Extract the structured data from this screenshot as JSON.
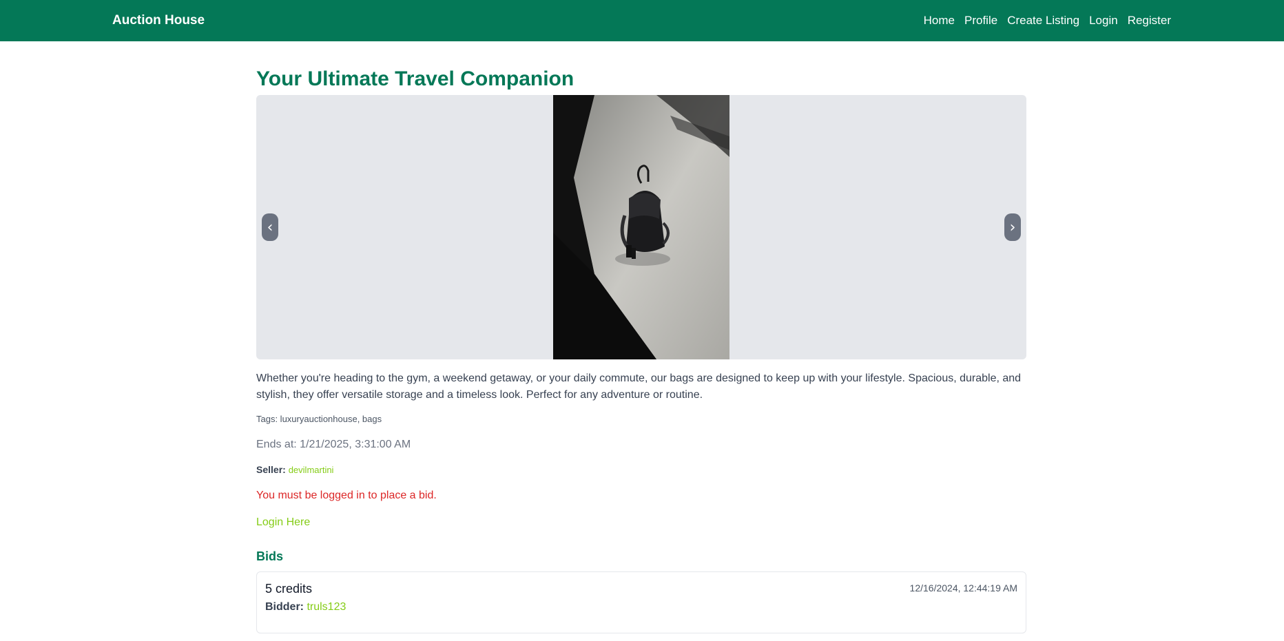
{
  "nav": {
    "brand": "Auction House",
    "links": [
      "Home",
      "Profile",
      "Create Listing",
      "Login",
      "Register"
    ]
  },
  "listing": {
    "title": "Your Ultimate Travel Companion",
    "description": "Whether you're heading to the gym, a weekend getaway, or your daily commute, our bags are designed to keep up with your lifestyle. Spacious, durable, and stylish, they offer versatile storage and a timeless look. Perfect for any adventure or routine.",
    "tags": "Tags: luxuryauctionhouse, bags",
    "ends_at": "Ends at: 1/21/2025, 3:31:00 AM",
    "seller_label": "Seller:",
    "seller_name": "devilmartini",
    "login_warning": "You must be logged in to place a bid.",
    "login_link": "Login Here"
  },
  "carousel": {
    "prev_icon": "‹",
    "next_icon": "›"
  },
  "bids": {
    "heading": "Bids",
    "items": [
      {
        "amount": "5 credits",
        "time": "12/16/2024, 12:44:19 AM",
        "bidder_label": "Bidder:",
        "bidder": "truls123"
      }
    ]
  },
  "colors": {
    "primary": "#047857",
    "link": "#84cc16",
    "error": "#dc2626"
  }
}
